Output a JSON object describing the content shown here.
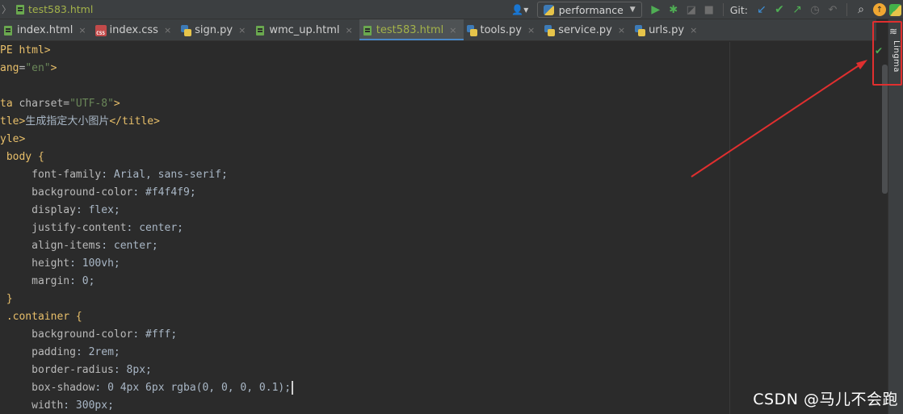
{
  "breadcrumb": {
    "file": "test583.html"
  },
  "toolbar": {
    "run_config": "performance",
    "git_label": "Git:"
  },
  "tabs": [
    {
      "label": "index.html",
      "icon": "html-file-icon"
    },
    {
      "label": "index.css",
      "icon": "css-file-icon"
    },
    {
      "label": "sign.py",
      "icon": "python-file-icon"
    },
    {
      "label": "wmc_up.html",
      "icon": "html-file-icon"
    },
    {
      "label": "test583.html",
      "icon": "html-file-icon",
      "active": true
    },
    {
      "label": "tools.py",
      "icon": "python-file-icon"
    },
    {
      "label": "service.py",
      "icon": "python-file-icon"
    },
    {
      "label": "urls.py",
      "icon": "python-file-icon"
    }
  ],
  "editor": {
    "lines": [
      [
        "PE html>"
      ],
      [
        "ang=\"en\">"
      ],
      [
        ""
      ],
      [
        "ta charset=\"UTF-8\">"
      ],
      [
        "tle>生成指定大小图片</title>"
      ],
      [
        "yle>"
      ],
      [
        " body {"
      ],
      [
        "     font-family: Arial, sans-serif;"
      ],
      [
        "     background-color: #f4f4f9;"
      ],
      [
        "     display: flex;"
      ],
      [
        "     justify-content: center;"
      ],
      [
        "     align-items: center;"
      ],
      [
        "     height: 100vh;"
      ],
      [
        "     margin: 0;"
      ],
      [
        " }"
      ],
      [
        " .container {"
      ],
      [
        "     background-color: #fff;"
      ],
      [
        "     padding: 2rem;"
      ],
      [
        "     border-radius: 8px;"
      ],
      [
        "     box-shadow: 0 4px 6px rgba(0, 0, 0, 0.1);"
      ],
      [
        "     width: 300px;"
      ]
    ]
  },
  "plugin": {
    "label": "Lingma"
  },
  "watermark": "CSDN @马儿不会跑",
  "colors": {
    "annotation": "#e02f2f",
    "active_tab_underline": "#4a88c7",
    "tag": "#e8bf6a",
    "string": "#6a8759"
  }
}
